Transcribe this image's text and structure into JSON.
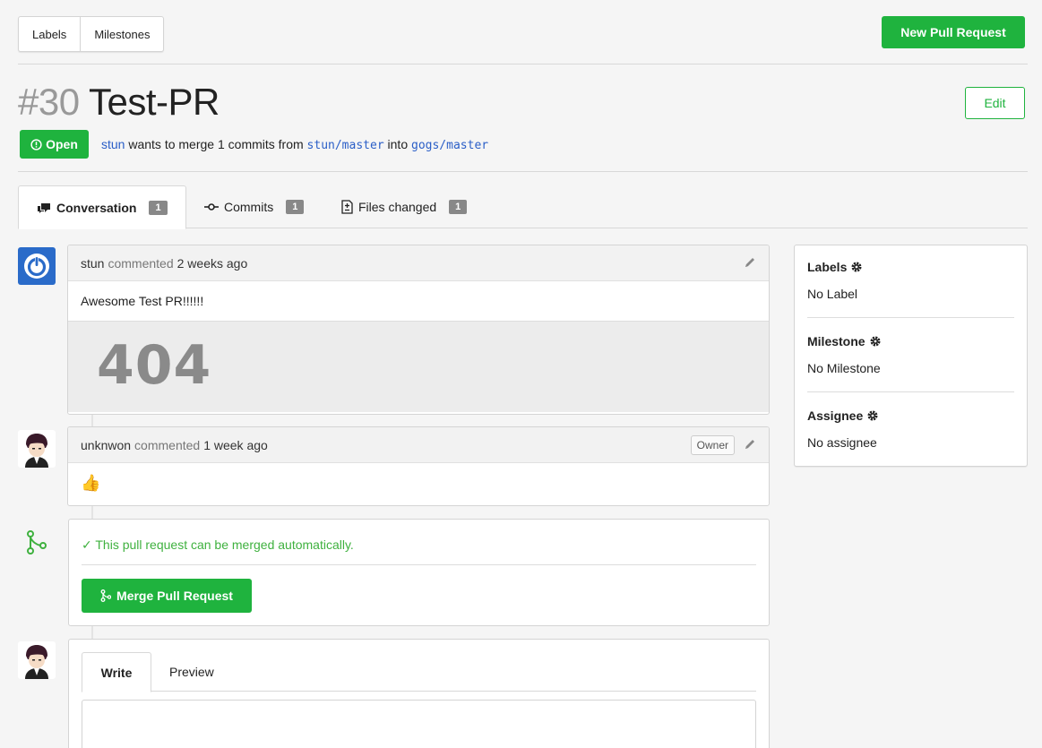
{
  "topnav": {
    "labels": "Labels",
    "milestones": "Milestones"
  },
  "actions": {
    "new_pr": "New Pull Request",
    "edit": "Edit"
  },
  "pr": {
    "number": "#30",
    "title": "Test-PR",
    "status": "Open",
    "author": "stun",
    "merge_text_1": "wants to merge",
    "commit_count": "1",
    "merge_text_2": "commits from",
    "head": "stun/master",
    "merge_text_3": "into",
    "base": "gogs/master"
  },
  "tabs": [
    {
      "label": "Conversation",
      "count": "1"
    },
    {
      "label": "Commits",
      "count": "1"
    },
    {
      "label": "Files changed",
      "count": "1"
    }
  ],
  "comments": [
    {
      "user": "stun",
      "action": "commented",
      "time": "2 weeks ago",
      "body": "Awesome Test PR!!!!!!",
      "image_text": "404"
    },
    {
      "user": "unknwon",
      "action": "commented",
      "time": "1 week ago",
      "badge": "Owner",
      "body": "👍"
    }
  ],
  "merge": {
    "status": "✓ This pull request can be merged automatically.",
    "button": "Merge Pull Request"
  },
  "editor": {
    "write": "Write",
    "preview": "Preview"
  },
  "sidebar": {
    "labels_title": "Labels",
    "labels_value": "No Label",
    "milestone_title": "Milestone",
    "milestone_value": "No Milestone",
    "assignee_title": "Assignee",
    "assignee_value": "No assignee"
  },
  "colors": {
    "accent_green": "#1fb33e",
    "link_blue": "#2a5ec7"
  }
}
